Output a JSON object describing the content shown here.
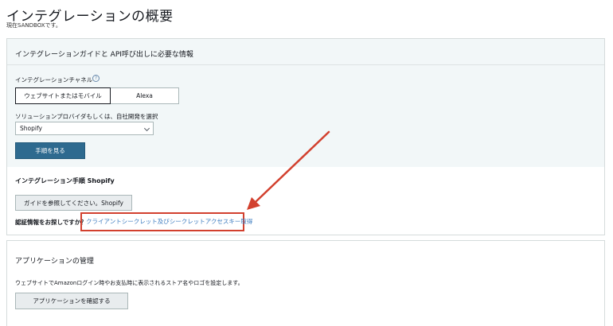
{
  "page": {
    "title": "インテグレーションの概要",
    "sandbox_note": "現在SANDBOXです。"
  },
  "integration_panel": {
    "title": "インテグレーションガイドと API呼び出しに必要な情報",
    "channel_label": "インテグレーションチャネル",
    "help_icon": "?",
    "channels": [
      "ウェブサイトまたはモバイル",
      "Alexa"
    ],
    "provider_label": "ソリューションプロバイダもしくは、自社開発を選択",
    "provider_value": "Shopify",
    "view_steps_label": "手順を見る",
    "steps_title": "インテグレーション手順 Shopify",
    "guide_button_label": "ガイドを参照してください。Shopify",
    "credentials_question": "認証情報をお探しですか？",
    "secret_link_label": "クライアントシークレット及びシークレットアクセスキー取得"
  },
  "app_panel": {
    "title": "アプリケーションの管理",
    "description": "ウェブサイトでAmazonログイン時やお支払時に表示されるストア名やロゴを設定します。",
    "confirm_button_label": "アプリケーションを確認する"
  },
  "colors": {
    "primary_button": "#2e6a8f",
    "annotation": "#d2402e",
    "link": "#3b7bbf"
  }
}
